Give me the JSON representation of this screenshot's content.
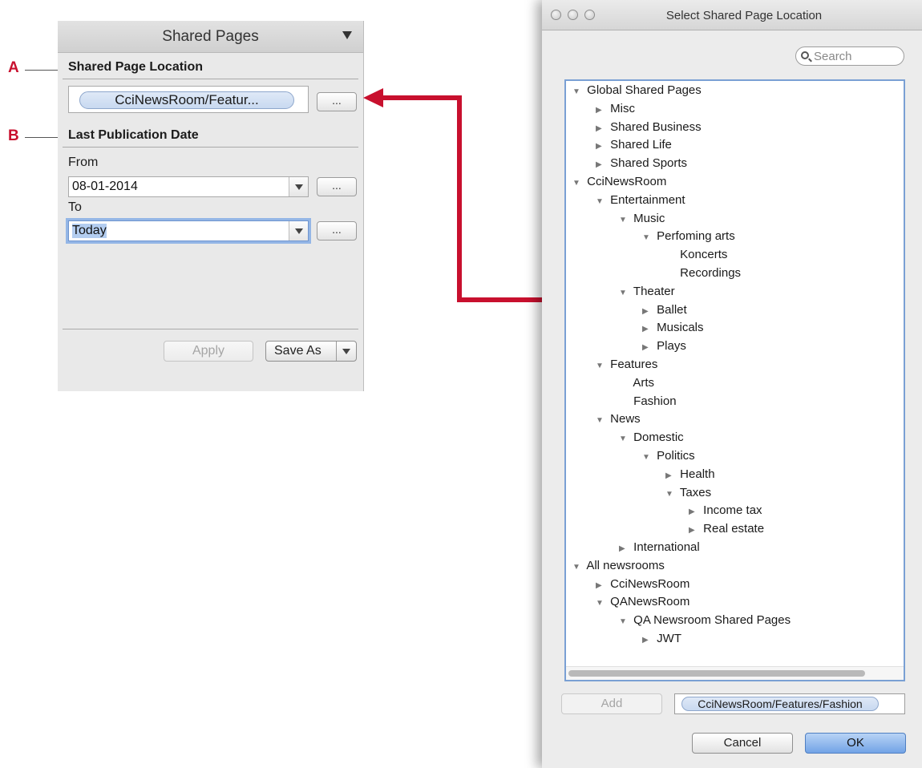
{
  "callouts": {
    "a": "A",
    "b": "B"
  },
  "shared_pages_panel": {
    "title": "Shared Pages",
    "location_section_title": "Shared Page Location",
    "location_token": "CciNewsRoom/Featur...",
    "browse_label": "...",
    "date_section_title": "Last Publication Date",
    "from_label": "From",
    "from_value": "08-01-2014",
    "to_label": "To",
    "to_value": "Today",
    "apply_label": "Apply",
    "save_as_label": "Save As"
  },
  "dialog": {
    "title": "Select Shared Page Location",
    "search_placeholder": "Search",
    "tree": [
      {
        "label": "Global Shared Pages",
        "depth": 0,
        "state": "expanded"
      },
      {
        "label": "Misc",
        "depth": 1,
        "state": "collapsed"
      },
      {
        "label": "Shared Business",
        "depth": 1,
        "state": "collapsed"
      },
      {
        "label": "Shared Life",
        "depth": 1,
        "state": "collapsed"
      },
      {
        "label": "Shared Sports",
        "depth": 1,
        "state": "collapsed"
      },
      {
        "label": "CciNewsRoom",
        "depth": 0,
        "state": "expanded"
      },
      {
        "label": "Entertainment",
        "depth": 1,
        "state": "expanded"
      },
      {
        "label": "Music",
        "depth": 2,
        "state": "expanded"
      },
      {
        "label": "Perfoming arts",
        "depth": 3,
        "state": "expanded"
      },
      {
        "label": "Koncerts",
        "depth": 4,
        "state": "leaf"
      },
      {
        "label": "Recordings",
        "depth": 4,
        "state": "leaf"
      },
      {
        "label": "Theater",
        "depth": 2,
        "state": "expanded"
      },
      {
        "label": "Ballet",
        "depth": 3,
        "state": "collapsed"
      },
      {
        "label": "Musicals",
        "depth": 3,
        "state": "collapsed"
      },
      {
        "label": "Plays",
        "depth": 3,
        "state": "collapsed"
      },
      {
        "label": "Features",
        "depth": 1,
        "state": "expanded"
      },
      {
        "label": "Arts",
        "depth": 2,
        "state": "leaf"
      },
      {
        "label": "Fashion",
        "depth": 2,
        "state": "leaf"
      },
      {
        "label": "News",
        "depth": 1,
        "state": "expanded"
      },
      {
        "label": "Domestic",
        "depth": 2,
        "state": "expanded"
      },
      {
        "label": "Politics",
        "depth": 3,
        "state": "expanded"
      },
      {
        "label": "Health",
        "depth": 4,
        "state": "collapsed"
      },
      {
        "label": "Taxes",
        "depth": 4,
        "state": "expanded"
      },
      {
        "label": "Income tax",
        "depth": 5,
        "state": "collapsed"
      },
      {
        "label": "Real estate",
        "depth": 5,
        "state": "collapsed"
      },
      {
        "label": "International",
        "depth": 2,
        "state": "collapsed"
      },
      {
        "label": "All newsrooms",
        "depth": 0,
        "state": "expanded"
      },
      {
        "label": "CciNewsRoom",
        "depth": 1,
        "state": "collapsed"
      },
      {
        "label": "QANewsRoom",
        "depth": 1,
        "state": "expanded"
      },
      {
        "label": "QA Newsroom Shared Pages",
        "depth": 2,
        "state": "expanded"
      },
      {
        "label": "JWT",
        "depth": 3,
        "state": "collapsed"
      }
    ],
    "add_label": "Add",
    "selected_path": "CciNewsRoom/Features/Fashion",
    "cancel_label": "Cancel",
    "ok_label": "OK"
  },
  "colors": {
    "callout_red": "#c8102e",
    "connector_red": "#c8102e",
    "focus_blue": "#94b6e6",
    "default_button_blue": "#72a3e6"
  }
}
